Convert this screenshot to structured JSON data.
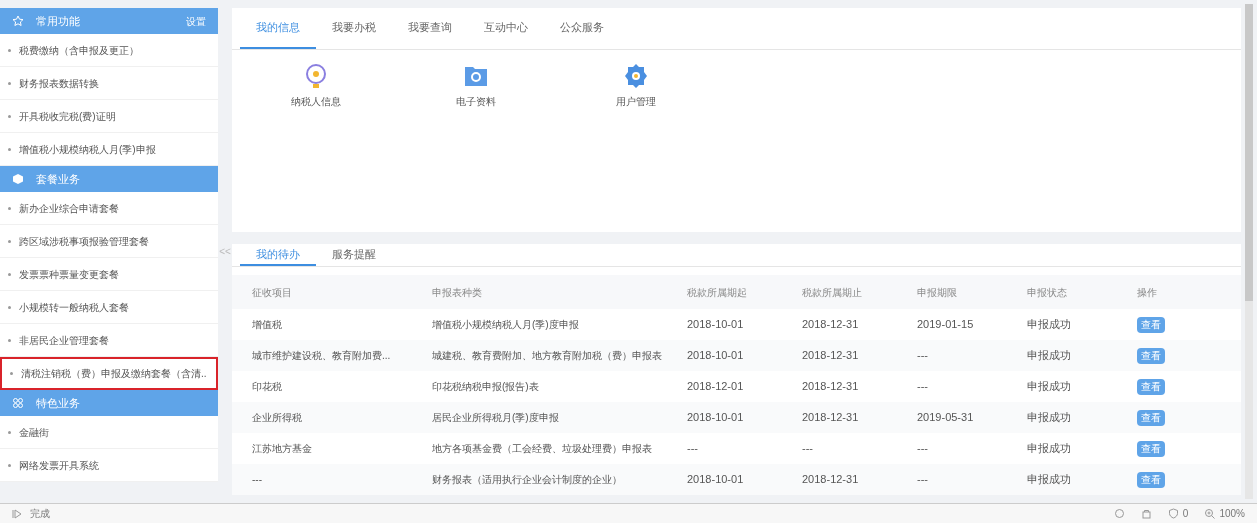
{
  "sidebar": {
    "sections": [
      {
        "title": "常用功能",
        "action": "设置",
        "items": [
          {
            "label": "税费缴纳（含申报及更正）",
            "highlighted": false
          },
          {
            "label": "财务报表数据转换",
            "highlighted": false
          },
          {
            "label": "开具税收完税(费)证明",
            "highlighted": false
          },
          {
            "label": "增值税小规模纳税人月(季)申报",
            "highlighted": false
          }
        ]
      },
      {
        "title": "套餐业务",
        "items": [
          {
            "label": "新办企业综合申请套餐",
            "highlighted": false
          },
          {
            "label": "跨区域涉税事项报验管理套餐",
            "highlighted": false
          },
          {
            "label": "发票票种票量变更套餐",
            "highlighted": false
          },
          {
            "label": "小规模转一般纳税人套餐",
            "highlighted": false
          },
          {
            "label": "非居民企业管理套餐",
            "highlighted": false
          },
          {
            "label": "清税注销税（费）申报及缴纳套餐（含清..",
            "highlighted": true
          }
        ]
      },
      {
        "title": "特色业务",
        "items": [
          {
            "label": "金融街",
            "highlighted": false
          },
          {
            "label": "网络发票开具系统",
            "highlighted": false
          }
        ]
      }
    ]
  },
  "collapse_handle": "<<",
  "top_tabs": [
    {
      "label": "我的信息",
      "selected": true
    },
    {
      "label": "我要办税",
      "selected": false
    },
    {
      "label": "我要查询",
      "selected": false
    },
    {
      "label": "互动中心",
      "selected": false
    },
    {
      "label": "公众服务",
      "selected": false
    }
  ],
  "shortcuts": [
    {
      "label": "纳税人信息",
      "kind": "bulb"
    },
    {
      "label": "电子资料",
      "kind": "folder"
    },
    {
      "label": "用户管理",
      "kind": "gear"
    }
  ],
  "bottom_tabs": [
    {
      "label": "我的待办",
      "selected": true
    },
    {
      "label": "服务提醒",
      "selected": false
    }
  ],
  "table": {
    "columns": [
      "征收项目",
      "申报表种类",
      "税款所属期起",
      "税款所属期止",
      "申报期限",
      "申报状态",
      "操作"
    ],
    "rows": [
      [
        "增值税",
        "增值税小规模纳税人月(季)度申报",
        "2018-10-01",
        "2018-12-31",
        "2019-01-15",
        "申报成功",
        "查看"
      ],
      [
        "城市维护建设税、教育附加费...",
        "城建税、教育费附加、地方教育附加税（费）申报表",
        "2018-10-01",
        "2018-12-31",
        "---",
        "申报成功",
        "查看"
      ],
      [
        "印花税",
        "印花税纳税申报(报告)表",
        "2018-12-01",
        "2018-12-31",
        "---",
        "申报成功",
        "查看"
      ],
      [
        "企业所得税",
        "居民企业所得税月(季)度申报",
        "2018-10-01",
        "2018-12-31",
        "2019-05-31",
        "申报成功",
        "查看"
      ],
      [
        "江苏地方基金",
        "地方各项基金费（工会经费、垃圾处理费）申报表",
        "---",
        "---",
        "---",
        "申报成功",
        "查看"
      ],
      [
        "---",
        "财务报表（适用执行企业会计制度的企业）",
        "2018-10-01",
        "2018-12-31",
        "---",
        "申报成功",
        "查看"
      ]
    ]
  },
  "status_bar": {
    "text": "完成",
    "count": "0",
    "zoom": "100%"
  }
}
